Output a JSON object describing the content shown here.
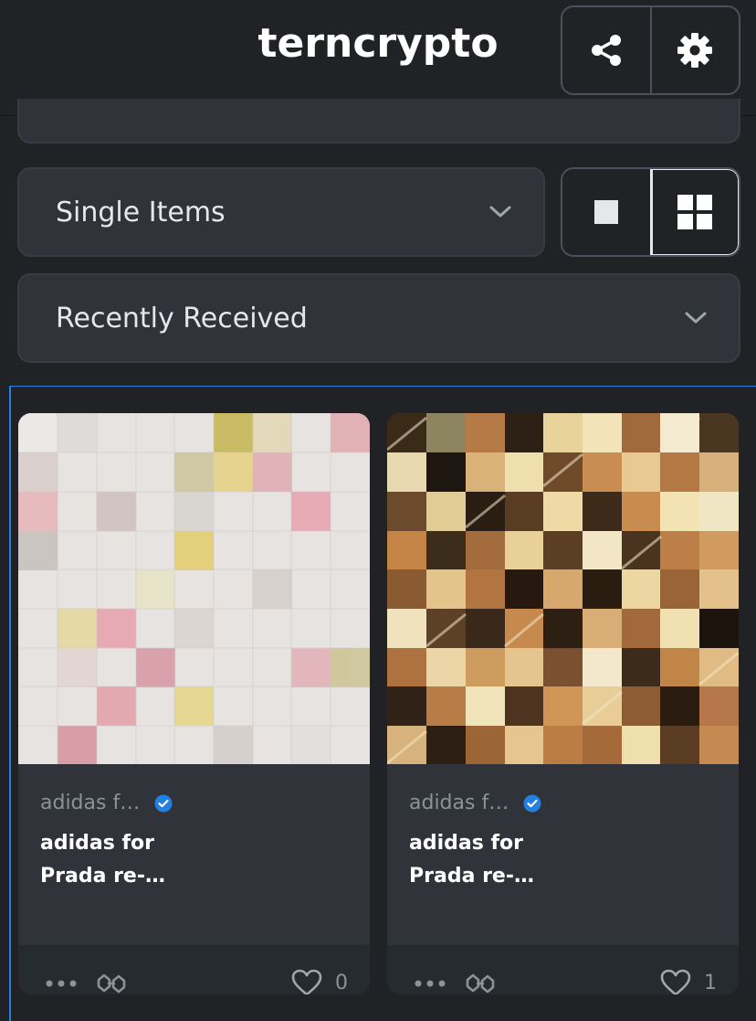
{
  "header": {
    "title": "terncrypto"
  },
  "filters": {
    "item_type": "Single Items",
    "sort": "Recently Received"
  },
  "cards": [
    {
      "collection": "adidas f…",
      "name": "adidas for Prada re-…",
      "likes": "0"
    },
    {
      "collection": "adidas f…",
      "name": "adidas for Prada re-…",
      "likes": "1"
    }
  ],
  "colors": {
    "background": "#202225",
    "card": "#303339",
    "accent": "#2081e2",
    "verified": "#2081e2"
  },
  "icons": [
    "share-icon",
    "gear-icon",
    "chevron-down-icon",
    "single-view-icon",
    "grid-view-icon",
    "verified-badge-icon",
    "more-icon",
    "link-icon",
    "heart-icon"
  ]
}
